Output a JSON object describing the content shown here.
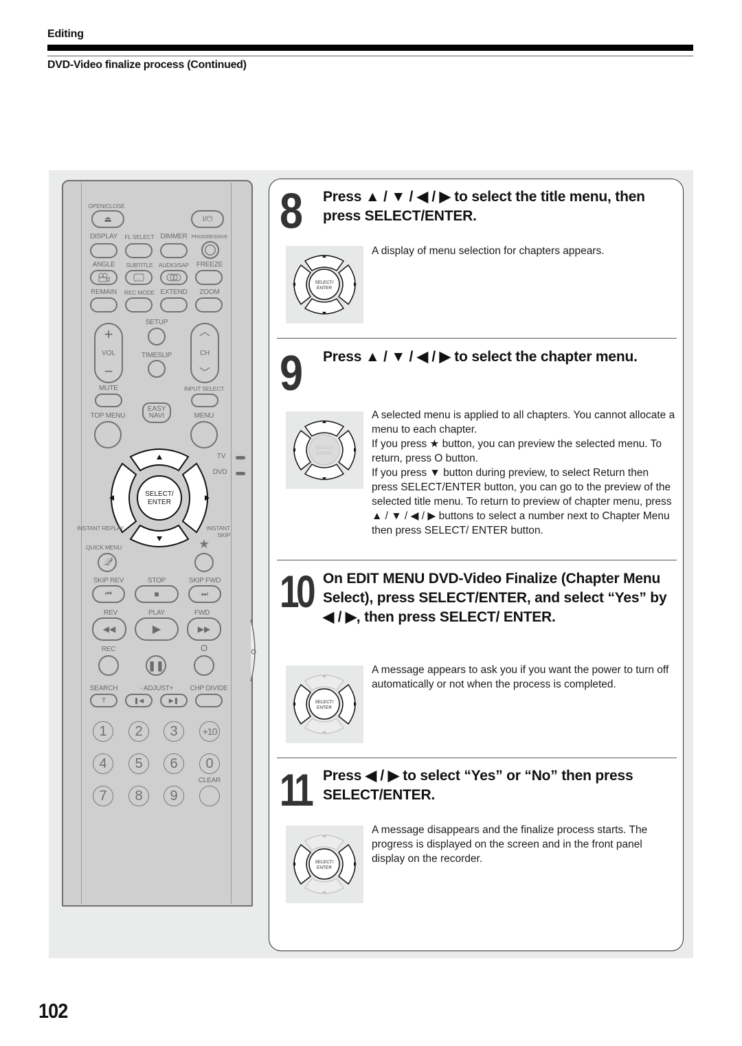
{
  "header": {
    "section_title": "Editing",
    "subsection_title": "DVD-Video finalize process (Continued)"
  },
  "remote": {
    "row1": {
      "open_close": "OPEN/CLOSE",
      "eject_icon": "⏏",
      "power_icon": "I/⏻"
    },
    "row2": {
      "labels": [
        "DISPLAY",
        "FL SELECT",
        "DIMMER",
        "PROGRESSIVE"
      ]
    },
    "row3": {
      "labels": [
        "ANGLE",
        "SUBTITLE",
        "AUDIO/SAP",
        "FREEZE"
      ]
    },
    "row4": {
      "labels": [
        "REMAIN",
        "REC MODE",
        "EXTEND",
        "ZOOM"
      ]
    },
    "mid": {
      "setup": "SETUP",
      "timeslip": "TIMESLIP",
      "vol": "VOL",
      "vol_plus": "+",
      "vol_minus": "−",
      "ch": "CH",
      "ch_up": "︿",
      "ch_down": "﹀",
      "mute": "MUTE",
      "input_select": "INPUT SELECT",
      "top_menu": "TOP MENU",
      "easy_navi": "EASY NAVI",
      "menu": "MENU",
      "tv": "TV",
      "dvd": "DVD"
    },
    "dpad": {
      "center": "SELECT/ ENTER",
      "up": "▲",
      "down": "▼",
      "left": "◀",
      "right": "▶",
      "instant_replay": "INSTANT REPLAY",
      "instant_skip": "INSTANT SKIP",
      "quick_menu": "QUICK MENU",
      "star": "★"
    },
    "transport": {
      "skip_rev": "SKIP REV",
      "stop": "STOP",
      "skip_fwd": "SKIP FWD",
      "rev": "REV",
      "play": "PLAY",
      "fwd": "FWD",
      "rec": "REC",
      "return_o": "O",
      "search": "SEARCH",
      "adjust": "- ADJUST+",
      "chp_divide": "CHP DIVIDE",
      "search_t": "T"
    },
    "numbers": [
      "1",
      "2",
      "3",
      "+10",
      "4",
      "5",
      "6",
      "0",
      "7",
      "8",
      "9"
    ],
    "clear": "CLEAR"
  },
  "pad_center_label": "SELECT/ ENTER",
  "steps": [
    {
      "number": "8",
      "heading": "Press ▲ / ▼ / ◀ / ▶ to select the title menu, then press SELECT/ENTER.",
      "body": [
        "A display of menu selection for chapters appears."
      ]
    },
    {
      "number": "9",
      "heading": "Press ▲ / ▼ / ◀ / ▶ to select the chapter menu.",
      "body": [
        "A selected menu is applied to all chapters. You cannot allocate a menu to each chapter.",
        "If you press ★ button, you can preview the selected menu. To return, press O button.",
        "If you press ▼ button during preview, to select  Return  then press SELECT/ENTER button, you can go to the preview of the selected title menu. To return to preview of chapter menu, press ▲ / ▼ / ◀ / ▶ buttons to select a number next to  Chapter Menu  then press SELECT/ ENTER button."
      ]
    },
    {
      "number": "10",
      "heading": "On EDIT MENU DVD-Video Finalize (Chapter Menu Select), press SELECT/ENTER, and select “Yes” by ◀ / ▶, then press SELECT/ ENTER.",
      "body": [
        "A message appears to ask you if you want the power to turn off automatically or not when the process is completed."
      ]
    },
    {
      "number": "11",
      "heading": "Press ◀ / ▶ to select “Yes” or “No” then press SELECT/ENTER.",
      "body": [
        "A message disappears and the finalize process starts. The progress is displayed on the screen and in the front panel display on the recorder."
      ]
    }
  ],
  "page_number": "102"
}
